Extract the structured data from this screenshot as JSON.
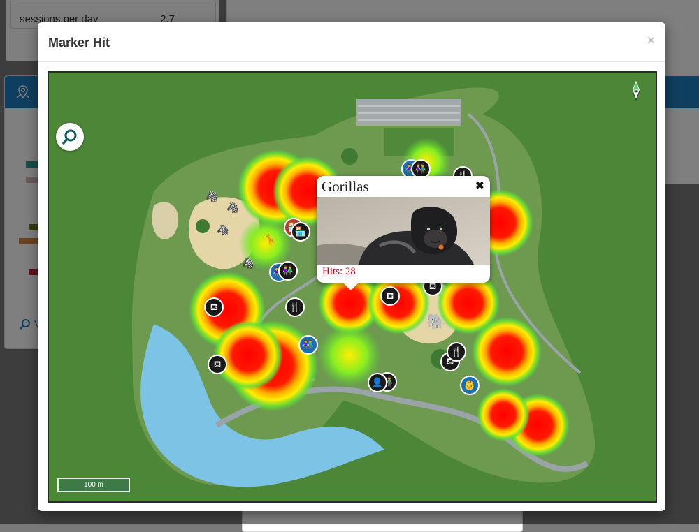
{
  "background": {
    "stat_label": "sessions per day",
    "stat_value": "2.7",
    "view_link": "V"
  },
  "modal": {
    "title": "Marker Hit",
    "close_glyph": "×"
  },
  "map": {
    "search_icon": "search-icon",
    "compass_icon": "compass-icon",
    "scale_label": "100 m",
    "markers": [
      {
        "icon": "picnic-table-icon",
        "glyph": "⛾"
      },
      {
        "icon": "restroom-icon",
        "glyph": "👫"
      },
      {
        "icon": "restaurant-icon",
        "glyph": "🍴"
      },
      {
        "icon": "baby-changing-icon",
        "glyph": "👶"
      },
      {
        "icon": "store-icon",
        "glyph": "🏪"
      },
      {
        "icon": "person-icon",
        "glyph": "👤"
      }
    ],
    "animals": [
      {
        "icon": "giraffe-icon",
        "glyph": "🦒"
      },
      {
        "icon": "zebra-icon",
        "glyph": "🦓"
      },
      {
        "icon": "elephant-icon",
        "glyph": "🐘"
      }
    ]
  },
  "popup": {
    "title": "Gorillas",
    "close_glyph": "✖",
    "hits_text": "Hits: 28"
  },
  "colors": {
    "map_grass": "#4c8637",
    "water": "#7cc3e6",
    "path": "#9aa4a8",
    "heat_red": "#ff0000",
    "heat_yellow": "#ffee00",
    "heat_green": "#55dd33",
    "brand_blue": "#1f7fc1",
    "hits_red": "#d0021b"
  }
}
